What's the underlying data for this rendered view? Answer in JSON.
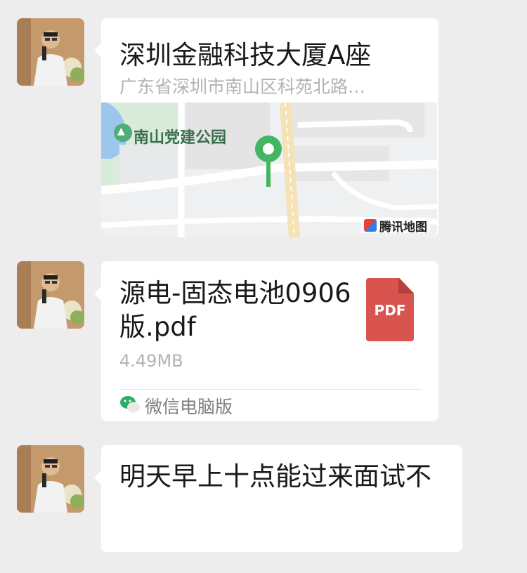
{
  "messages": [
    {
      "type": "location",
      "title": "深圳金融科技大厦A座",
      "address": "广东省深圳市南山区科苑北路…",
      "map": {
        "poi_label": "南山党建公园",
        "provider_label": "腾讯地图",
        "pin_color": "#43b661"
      }
    },
    {
      "type": "file",
      "file_name": "源电-固态电池0906版.pdf",
      "file_size": "4.49MB",
      "file_type_label": "PDF",
      "source_label": "微信电脑版",
      "icon_color": "#d9534f"
    },
    {
      "type": "text",
      "text": "明天早上十点能过来面试不"
    }
  ],
  "colors": {
    "background": "#ededed",
    "bubble": "#ffffff",
    "wechat_green": "#2aae67"
  }
}
